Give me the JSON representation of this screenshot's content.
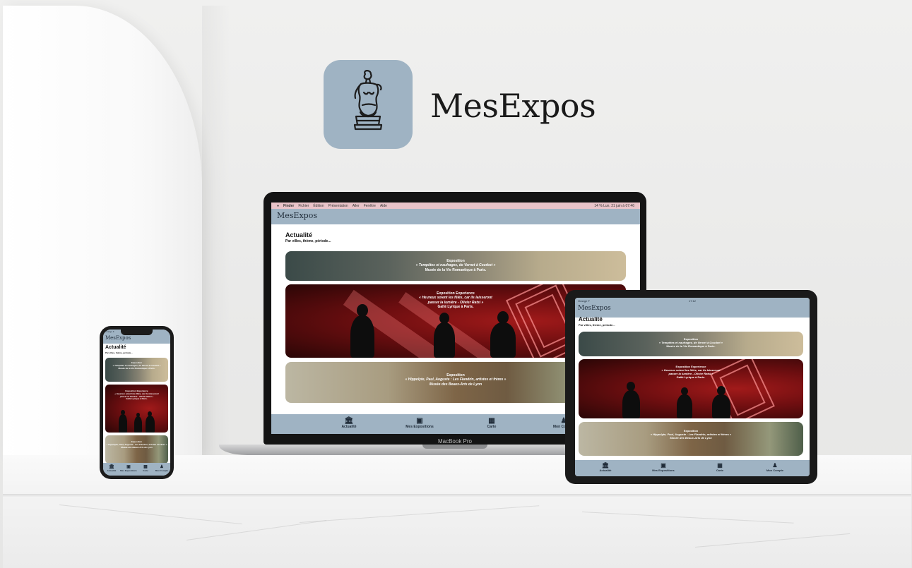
{
  "brand": {
    "name": "MesExpos",
    "icon_color": "#9fb3c3",
    "icon": "venus-statue-icon"
  },
  "laptop": {
    "model_label": "MacBook Pro",
    "menubar": {
      "items": [
        "Finder",
        "Fichier",
        "Édition",
        "Présentation",
        "Aller",
        "Fenêtre",
        "Aide"
      ],
      "status": "14 %   Lun. 21 juin à 07:46"
    }
  },
  "tablet": {
    "status_left": "Orange F",
    "status_center": "17:12"
  },
  "phone": {
    "status_left": "Orange F"
  },
  "app": {
    "title": "MesExpos",
    "header_color": "#9fb3c3",
    "section_title": "Actualité",
    "section_subtitle": "Par villes, thème, période...",
    "cards": [
      {
        "kind": "Exposition",
        "title": "« Tempêtes et naufrages, de Vernet à Courbet »",
        "venue": "Musée de la Vie Romantique à Paris."
      },
      {
        "kind": "Exposition Experience",
        "title": "« Heureux soient les fêlés, car ils laisseront passer la lumière - Olivier Ratsi »",
        "title_line1": "« Heureux soient les fêlés, car ils laisseront",
        "title_line2": "passer la lumière - Olivier Ratsi »",
        "venue": "Gaîté Lyrique à Paris."
      },
      {
        "kind": "Exposition",
        "title": "« Hippolyte, Paul, Auguste : Les Flandrin, artistes et frères »",
        "venue": "Musée des Beaux-Arts de Lyon"
      }
    ],
    "tabs": [
      {
        "label": "Actualité",
        "icon": "museum-icon"
      },
      {
        "label": "Mes Expositions",
        "icon": "gallery-icon"
      },
      {
        "label": "Carte",
        "icon": "map-icon"
      },
      {
        "label": "Mon Compte",
        "icon": "account-statue-icon"
      }
    ]
  }
}
